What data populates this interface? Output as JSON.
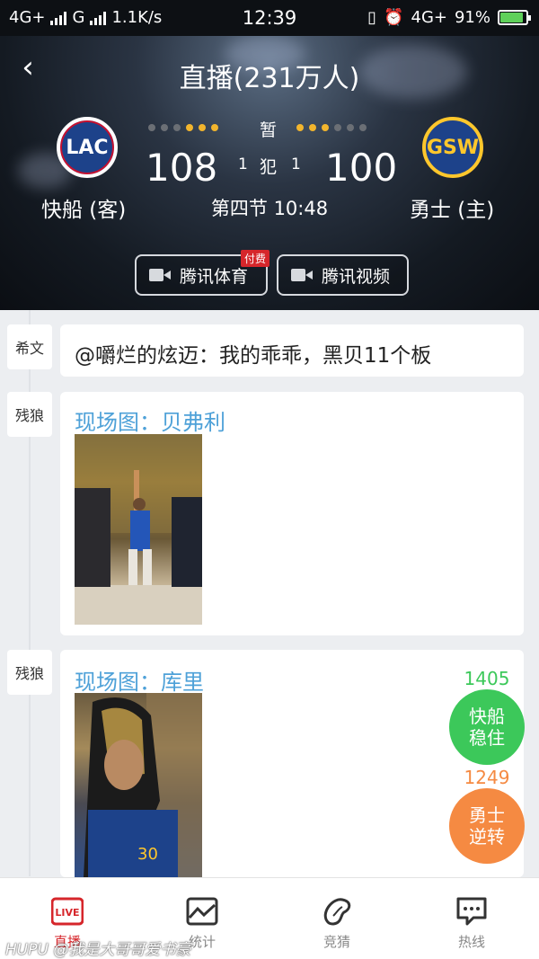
{
  "status_bar": {
    "network_left": "4G+",
    "network_g": "G",
    "speed": "1.1K/s",
    "time": "12:39",
    "network_right": "4G+",
    "battery": "91%",
    "battery_level": 0.91,
    "battery_color": "#5fd05a"
  },
  "header": {
    "title": "直播(231万人)",
    "back_icon": "chevron-left-icon",
    "away_team": {
      "abbr": "LAC",
      "name": "快船 (客)",
      "score": "108",
      "fouls": "1"
    },
    "home_team": {
      "abbr": "GSW",
      "name": "勇士 (主)",
      "score": "100",
      "fouls": "1"
    },
    "pause_label": "暂",
    "foul_label": "犯",
    "period": "第四节 10:48",
    "timeouts": {
      "away_dots": [
        false,
        false,
        false,
        true,
        true,
        true
      ],
      "home_dots": [
        true,
        true,
        true,
        false,
        false,
        false
      ]
    },
    "stream_buttons": [
      {
        "label": "腾讯体育",
        "tag": "付费"
      },
      {
        "label": "腾讯视频",
        "tag": ""
      }
    ]
  },
  "feed": [
    {
      "author": "希文",
      "text": "@嚼烂的炫迈：我的乖乖，黑贝11个板"
    },
    {
      "author": "残狼",
      "text": "现场图：贝弗利"
    },
    {
      "author": "残狼",
      "text": "现场图：库里"
    }
  ],
  "vote": {
    "away": {
      "count": "1405",
      "label_line1": "快船",
      "label_line2": "稳住",
      "color": "#3cc85a"
    },
    "home": {
      "count": "1249",
      "label_line1": "勇士",
      "label_line2": "逆转",
      "color": "#f58a42"
    }
  },
  "tabbar": {
    "items": [
      {
        "label": "直播",
        "icon": "live-icon",
        "icon_text": "LIVE",
        "active": true
      },
      {
        "label": "统计",
        "icon": "stats-icon",
        "active": false
      },
      {
        "label": "竞猜",
        "icon": "guess-icon",
        "active": false
      },
      {
        "label": "热线",
        "icon": "hotline-icon",
        "active": false
      }
    ],
    "active_color": "#d6262b"
  },
  "watermark": "HUPU @我是大哥哥爱书豪"
}
